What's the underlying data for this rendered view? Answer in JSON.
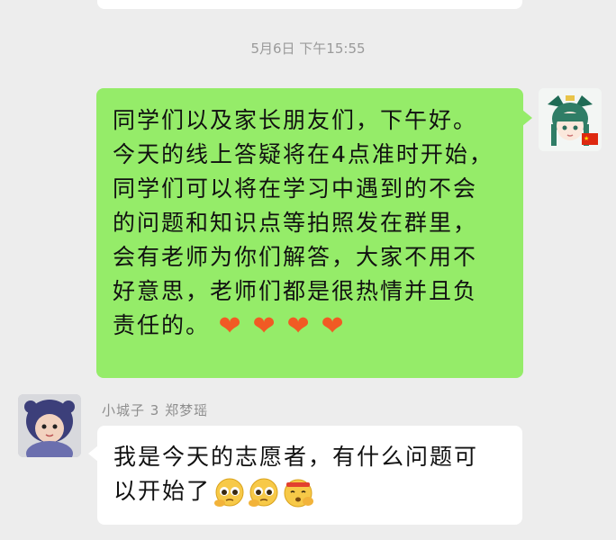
{
  "timestamp": "5月6日 下午15:55",
  "outgoing_message": {
    "lines": [
      "同学们以及家长朋友们，下午好。",
      "今天的线上答疑将在4点准时开始，",
      "同学们可以将在学习中遇到的不会",
      "的问题和知识点等拍照发在群里，",
      "会有老师为你们解答，大家不用不",
      "好意思，老师们都是很热情并且负",
      "责任的。"
    ],
    "hearts": [
      "❤",
      "❤",
      "❤",
      "❤"
    ],
    "bubble_color": "#95ec69"
  },
  "incoming_message": {
    "sender": "小城子 3 郑梦瑶",
    "lines": [
      "我是今天的志愿者，有什么问题可",
      "以开始了"
    ],
    "emojis": [
      "pleading-face-icon",
      "pleading-face-icon",
      "saluting-face-icon"
    ],
    "bubble_color": "#ffffff"
  },
  "colors": {
    "background": "#ededed",
    "heart": "#f15a24"
  }
}
